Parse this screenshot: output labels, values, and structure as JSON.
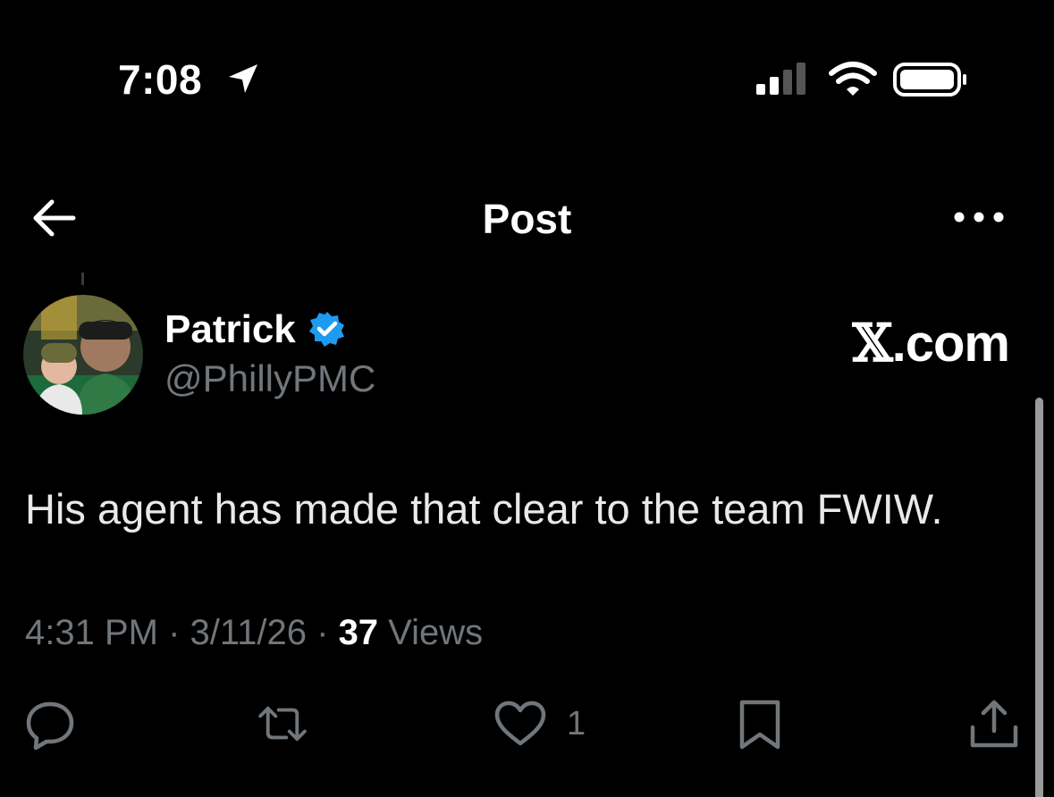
{
  "status_bar": {
    "time": "7:08",
    "icons": [
      "location-arrow-icon",
      "cellular-signal-icon",
      "wifi-icon",
      "battery-icon"
    ]
  },
  "header": {
    "title": "Post",
    "back_icon": "arrow-left-icon",
    "more_icon": "more-horizontal-icon"
  },
  "author": {
    "name": "Patrick",
    "handle": "@PhillyPMC",
    "verified": true,
    "verified_color": "#1d9bf0"
  },
  "watermark": {
    "x": "𝕏",
    "domain": ".com"
  },
  "post": {
    "text": "His agent has made that clear to the team FWIW.",
    "time": "4:31 PM",
    "sep1": " · ",
    "date": "3/11/26",
    "sep2": " · ",
    "views_count": "37",
    "views_label": " Views"
  },
  "actions": {
    "reply_icon": "reply-bubble-icon",
    "repost_icon": "repost-icon",
    "like_icon": "heart-icon",
    "like_count": "1",
    "bookmark_icon": "bookmark-icon",
    "share_icon": "share-icon"
  },
  "colors": {
    "background": "#000000",
    "text": "#e7e9ea",
    "muted": "#71767b",
    "accent": "#1d9bf0"
  }
}
